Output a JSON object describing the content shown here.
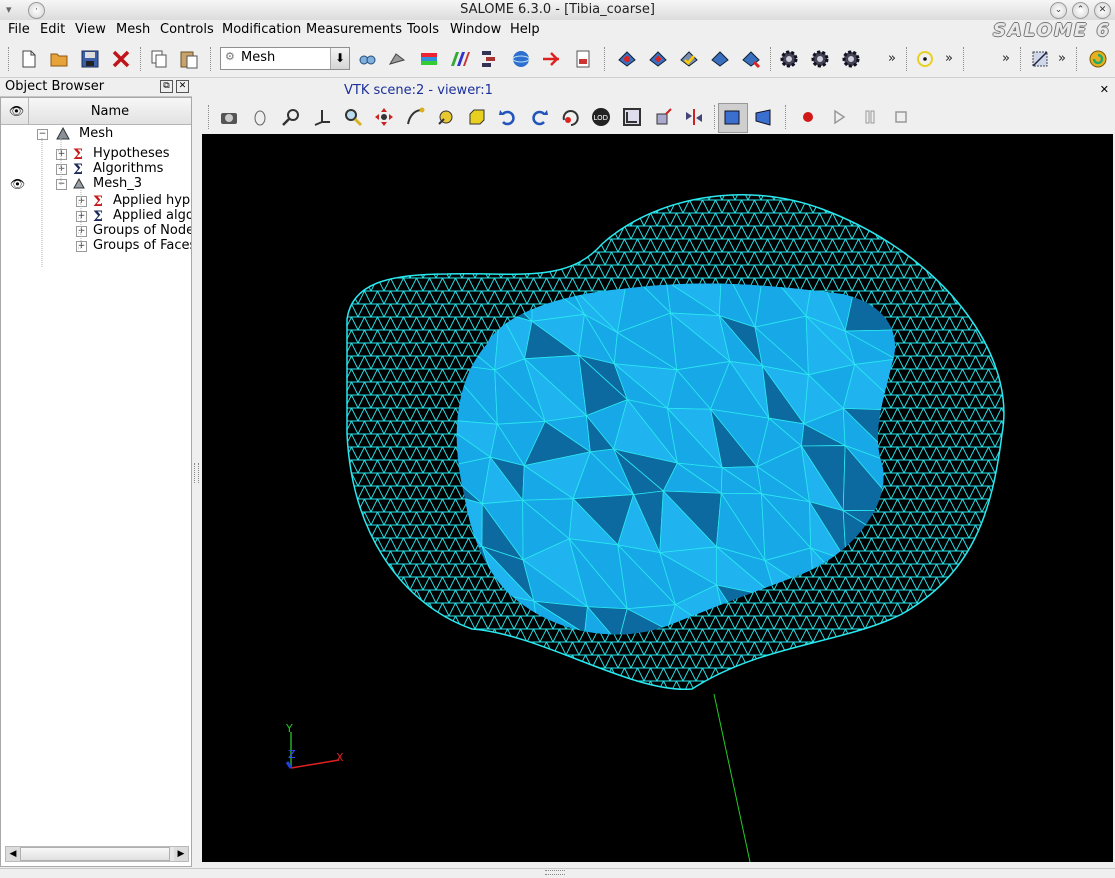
{
  "window": {
    "title": "SALOME 6.3.0 - [Tibia_coarse]"
  },
  "menubar": {
    "items": [
      "File",
      "Edit",
      "View",
      "Mesh",
      "Controls",
      "Modification",
      "Measurements",
      "Tools",
      "Window",
      "Help"
    ],
    "logo_text": "SALOME 6"
  },
  "toolbar": {
    "module_combo_value": "Mesh",
    "more_label": "»",
    "icons": [
      "new-document-icon",
      "open-folder-icon",
      "save-icon",
      "close-document-icon",
      "copy-icon",
      "paste-icon",
      "find-icon",
      "mesh-module-icon",
      "geometry-module-icon",
      "post-pro-module-icon",
      "yacs-icon",
      "paravis-icon",
      "eficas-icon",
      "med-icon",
      "create-mesh-icon",
      "edit-mesh-icon",
      "compute-mesh-icon",
      "mesh-info-icon",
      "mesh-order-icon",
      "settings-gear-icon",
      "settings-gear-2-icon",
      "settings-gear-3-icon",
      "select-node-icon",
      "select-edge-icon",
      "clipping-icon",
      "reset-icon"
    ]
  },
  "object_browser": {
    "title": "Object Browser",
    "column_name": "Name",
    "tree": [
      {
        "label": "Mesh",
        "level": 1,
        "icon": "mesh-component-icon",
        "expanded": true,
        "eye": false
      },
      {
        "label": "Hypotheses",
        "level": 2,
        "icon": "hypothesis-icon",
        "expanded": false,
        "eye": false
      },
      {
        "label": "Algorithms",
        "level": 2,
        "icon": "algorithm-icon",
        "expanded": false,
        "eye": false
      },
      {
        "label": "Mesh_3",
        "level": 2,
        "icon": "mesh-object-icon",
        "expanded": true,
        "eye": true
      },
      {
        "label": "Applied hypotheses",
        "level": 3,
        "icon": "hypothesis-icon",
        "expanded": false,
        "eye": false
      },
      {
        "label": "Applied algorithms",
        "level": 3,
        "icon": "algorithm-icon",
        "expanded": false,
        "eye": false
      },
      {
        "label": "Groups of Nodes",
        "level": 3,
        "icon": "",
        "expanded": false,
        "eye": false
      },
      {
        "label": "Groups of Faces",
        "level": 3,
        "icon": "",
        "expanded": false,
        "eye": false
      }
    ]
  },
  "viewer": {
    "tab_label": "VTK scene:2 - viewer:1",
    "axes": {
      "x_label": "X",
      "y_label": "Y",
      "z_label": "Z"
    },
    "toolbar_icons": [
      "dump-view-icon",
      "interaction-style-icon",
      "zoom-style-icon",
      "show-trihedron-icon",
      "fit-all-icon",
      "fit-area-icon",
      "zoom-icon",
      "pan-icon",
      "global-pan-icon",
      "rotate-icon",
      "rotation-point-icon",
      "rotate-left-icon",
      "rotate-right-icon",
      "reset-view-icon",
      "lod-icon",
      "graduated-axes-icon",
      "clipping-icon",
      "scaling-icon",
      "parallel-projection-icon",
      "perspective-projection-icon",
      "record-icon",
      "play-icon",
      "pause-icon",
      "stop-icon"
    ],
    "colors": {
      "background": "#000000",
      "mesh_wire": "#29e8ef",
      "face_fill": "#17a8e8",
      "face_dark": "#0c6aa0"
    }
  }
}
